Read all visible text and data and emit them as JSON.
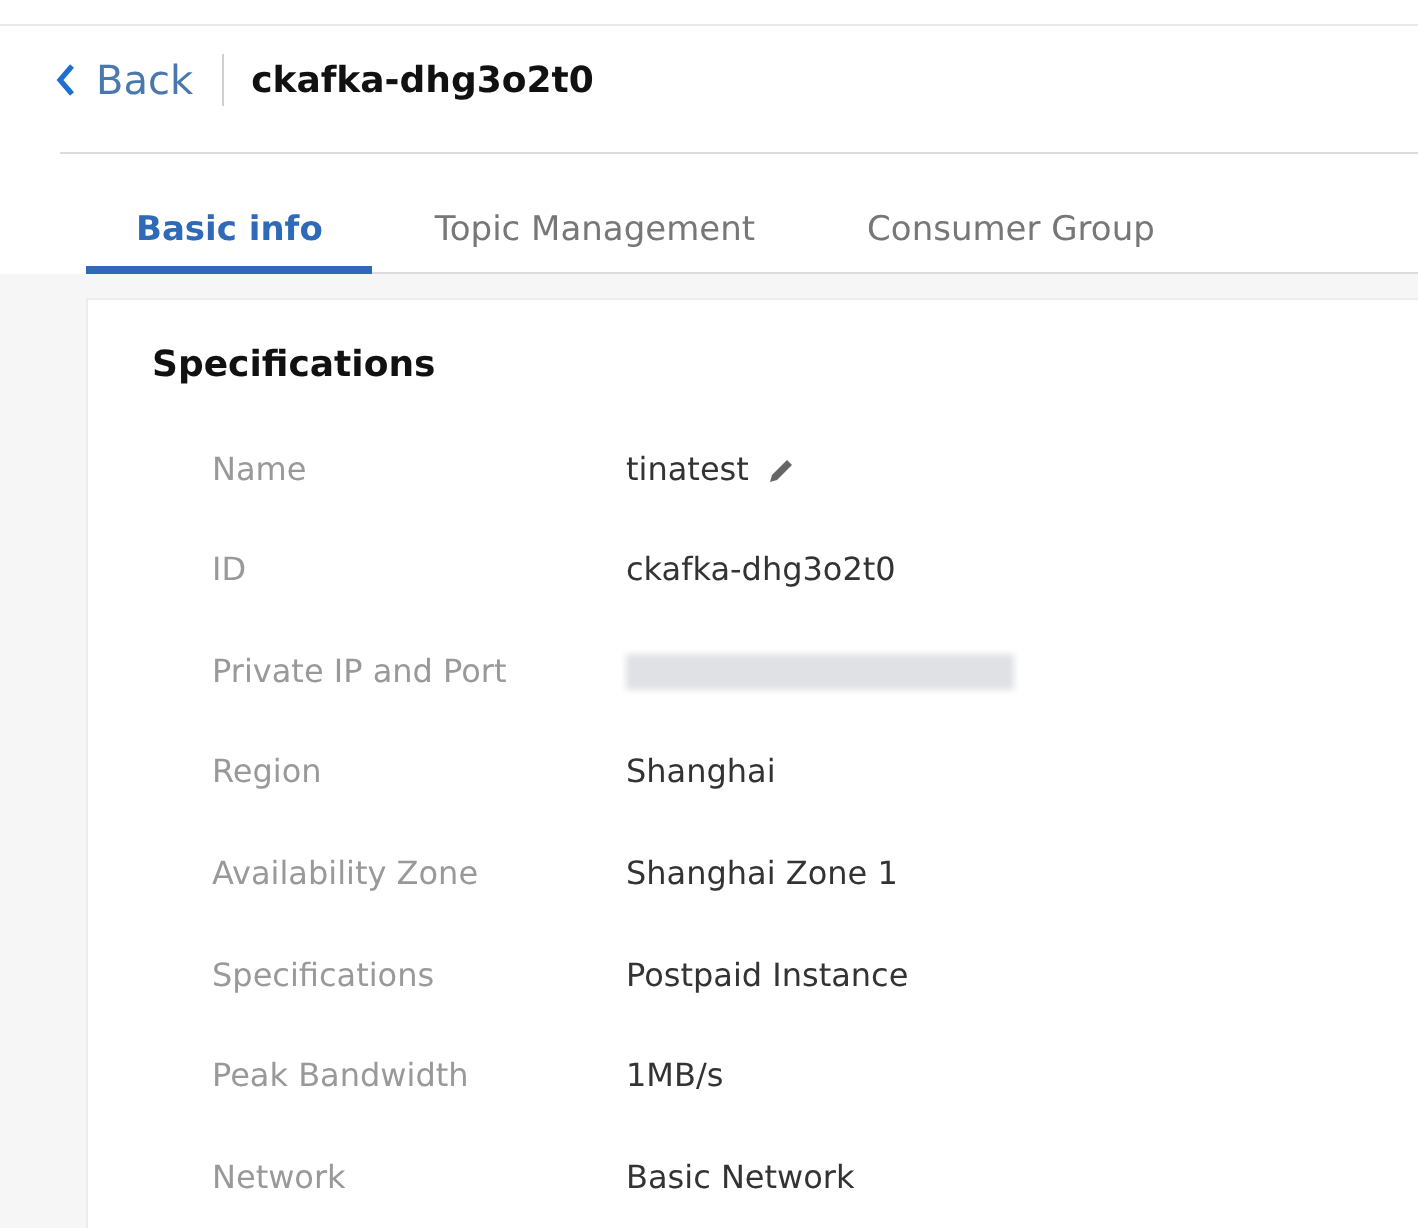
{
  "header": {
    "back_label": "Back",
    "title": "ckafka-dhg3o2t0"
  },
  "tabs": [
    {
      "label": "Basic info",
      "selected": true
    },
    {
      "label": "Topic Management",
      "selected": false
    },
    {
      "label": "Consumer Group",
      "selected": false
    }
  ],
  "section": {
    "title": "Specifications",
    "rows": [
      {
        "label": "Name",
        "value": "tinatest",
        "kind": "editable"
      },
      {
        "label": "ID",
        "value": "ckafka-dhg3o2t0",
        "kind": "text"
      },
      {
        "label": "Private IP and Port",
        "kind": "redacted"
      },
      {
        "label": "Region",
        "value": "Shanghai",
        "kind": "text"
      },
      {
        "label": "Availability Zone",
        "value": "Shanghai Zone 1",
        "kind": "text"
      },
      {
        "label": "Specifications",
        "value": "Postpaid Instance",
        "kind": "text"
      },
      {
        "label": "Peak Bandwidth",
        "value": "1MB/s",
        "kind": "text"
      },
      {
        "label": "Network",
        "value": "Basic Network",
        "kind": "text"
      }
    ]
  }
}
